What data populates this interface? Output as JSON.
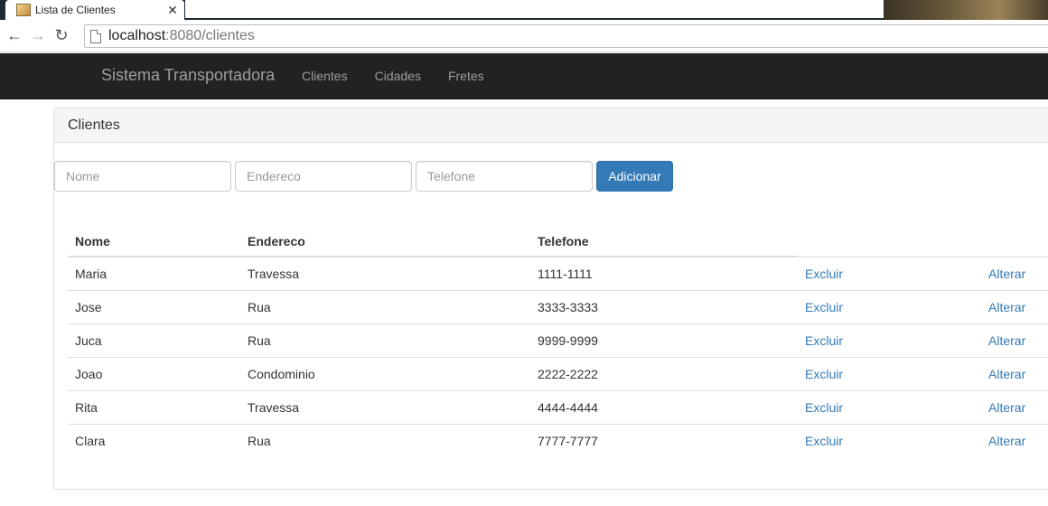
{
  "browser": {
    "tab_title": "Lista de Clientes",
    "url_host": "localhost",
    "url_rest": ":8080/clientes"
  },
  "navbar": {
    "brand": "Sistema Transportadora",
    "links": [
      "Clientes",
      "Cidades",
      "Fretes"
    ]
  },
  "panel": {
    "title": "Clientes"
  },
  "form": {
    "nome_placeholder": "Nome",
    "endereco_placeholder": "Endereco",
    "telefone_placeholder": "Telefone",
    "submit_label": "Adicionar"
  },
  "table": {
    "headers": [
      "Nome",
      "Endereco",
      "Telefone"
    ],
    "delete_label": "Excluir",
    "edit_label": "Alterar",
    "rows": [
      {
        "nome": "Maria",
        "endereco": "Travessa",
        "telefone": "1111-1111"
      },
      {
        "nome": "Jose",
        "endereco": "Rua",
        "telefone": "3333-3333"
      },
      {
        "nome": "Juca",
        "endereco": "Rua",
        "telefone": "9999-9999"
      },
      {
        "nome": "Joao",
        "endereco": "Condominio",
        "telefone": "2222-2222"
      },
      {
        "nome": "Rita",
        "endereco": "Travessa",
        "telefone": "4444-4444"
      },
      {
        "nome": "Clara",
        "endereco": "Rua",
        "telefone": "7777-7777"
      }
    ]
  }
}
